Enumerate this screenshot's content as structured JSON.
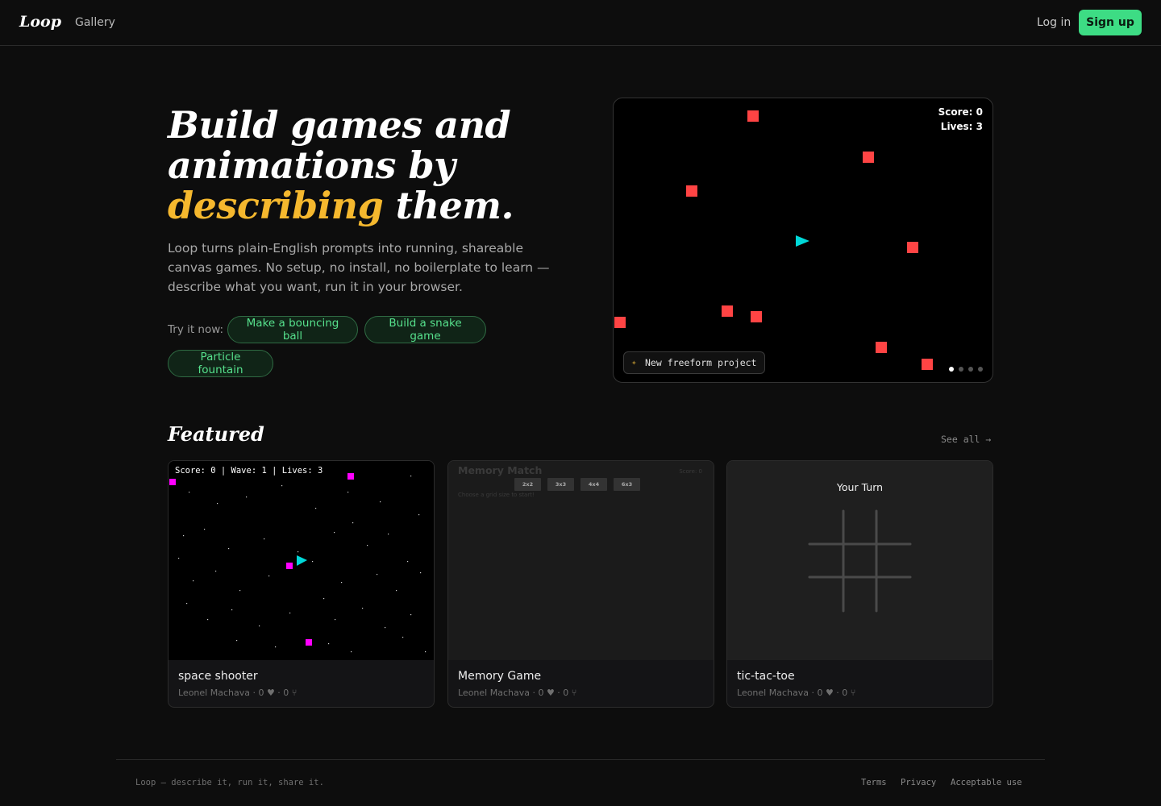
{
  "header": {
    "logo": "Loop",
    "nav_gallery": "Gallery",
    "login": "Log in",
    "signup": "Sign up"
  },
  "hero": {
    "title_line1": "Build games and",
    "title_line2": "animations by",
    "title_accent": "describing",
    "title_end": " them.",
    "description": "Loop turns plain-English prompts into running, shareable canvas games. No setup, no install, no boilerplate to learn — describe what you want, run it in your browser.",
    "try_label": "Try it now:",
    "chips": [
      "Make a bouncing ball",
      "Build a snake game",
      "Particle fountain"
    ]
  },
  "preview": {
    "score": "Score: 0",
    "lives": "Lives: 3",
    "badge": "New freeform project",
    "slide_count": 4,
    "active_slide": 0,
    "colors": {
      "enemy": "#ff4444",
      "player": "#00d8d8"
    }
  },
  "featured": {
    "title": "Featured",
    "see_all": "See all →",
    "cards": [
      {
        "title": "space shooter",
        "meta": "Leonel Machava · 0 ♥ · 0 ⑂",
        "hud": "Score: 0 | Wave: 1 | Lives: 3"
      },
      {
        "title": "Memory Game",
        "meta": "Leonel Machava · 0 ♥ · 0 ⑂",
        "game_title": "Memory Match",
        "score": "Score: 0",
        "grid_buttons": [
          "2x2",
          "3x3",
          "4x4",
          "6x3"
        ],
        "subtitle": "Choose a grid size to start!"
      },
      {
        "title": "tic-tac-toe",
        "meta": "Leonel Machava · 0 ♥ · 0 ⑂",
        "status": "Your Turn"
      }
    ]
  },
  "footer": {
    "tagline": "Loop — describe it, run it, share it.",
    "links": [
      "Terms",
      "Privacy",
      "Acceptable use"
    ]
  }
}
